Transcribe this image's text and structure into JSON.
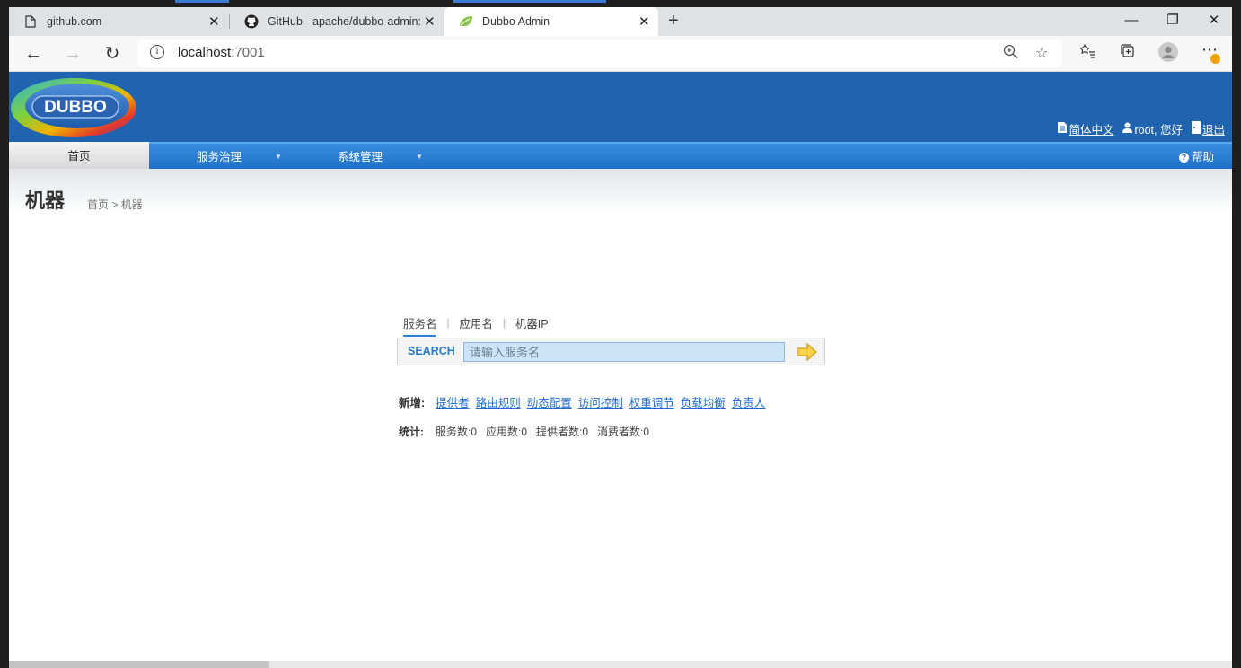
{
  "browser": {
    "tabs": [
      {
        "label": "github.com",
        "icon": "file-icon"
      },
      {
        "label": "GitHub - apache/dubbo-admin: a",
        "icon": "github-icon"
      },
      {
        "label": "Dubbo Admin",
        "icon": "leaf-icon",
        "active": true
      }
    ],
    "address": {
      "host": "localhost",
      "port": ":7001"
    }
  },
  "header": {
    "logo_text": "DUBBO",
    "language": "简体中文",
    "user": "root, 您好",
    "logout": "退出"
  },
  "menu": {
    "home": "首页",
    "service_governance": "服务治理",
    "system_admin": "系统管理",
    "help": "帮助"
  },
  "page": {
    "title": "机器",
    "breadcrumb": "首页 > 机器"
  },
  "search": {
    "tabs": [
      "服务名",
      "应用名",
      "机器IP"
    ],
    "label": "SEARCH",
    "placeholder": "请输入服务名"
  },
  "new_links": {
    "label": "新增:",
    "items": [
      "提供者",
      "路由规则",
      "动态配置",
      "访问控制",
      "权重调节",
      "负载均衡",
      "负责人"
    ]
  },
  "stats": {
    "label": "统计:",
    "items": [
      "服务数:0",
      "应用数:0",
      "提供者数:0",
      "消费者数:0"
    ]
  },
  "colors": {
    "header": "#2064b0",
    "menu": "#2d7fd9",
    "link": "#1a6ad0"
  }
}
